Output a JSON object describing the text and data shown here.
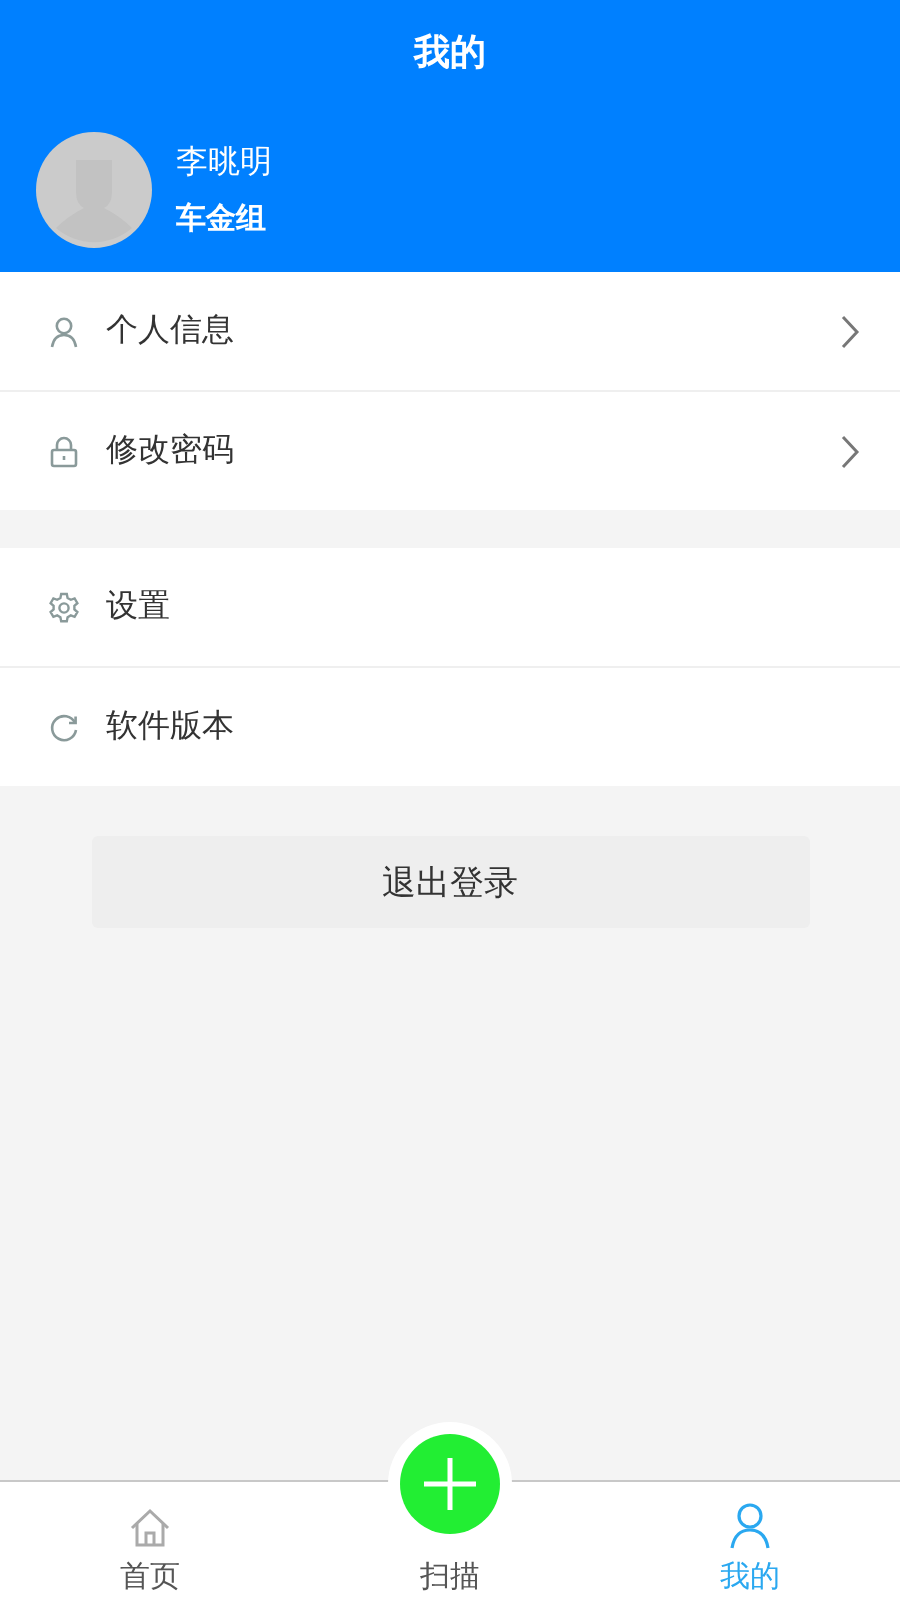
{
  "header": {
    "title": "我的"
  },
  "profile": {
    "name": "李晀明",
    "group": "车金组"
  },
  "menu_groups": [
    {
      "items": [
        {
          "kind": "person",
          "label": "个人信息",
          "arrow": true
        },
        {
          "kind": "lock",
          "label": "修改密码",
          "arrow": true
        }
      ]
    },
    {
      "items": [
        {
          "kind": "gear",
          "label": "设置",
          "arrow": false
        },
        {
          "kind": "refresh",
          "label": "软件版本",
          "arrow": false
        }
      ]
    }
  ],
  "logout_button": "退出登录",
  "tabs": [
    {
      "kind": "home",
      "label": "首页",
      "selected": false
    },
    {
      "kind": "scan",
      "label": "扫描",
      "selected": false
    },
    {
      "kind": "me",
      "label": "我的",
      "selected": true
    }
  ]
}
